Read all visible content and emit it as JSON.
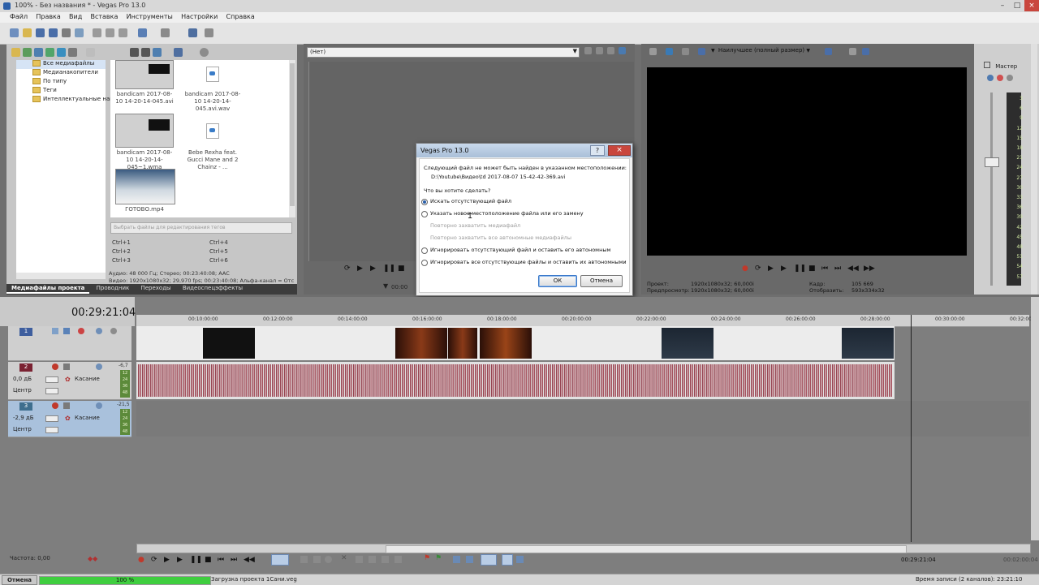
{
  "window": {
    "title": "100% - Без названия * - Vegas Pro 13.0"
  },
  "menu": [
    "Файл",
    "Правка",
    "Вид",
    "Вставка",
    "Инструменты",
    "Настройки",
    "Справка"
  ],
  "explorer": {
    "tree": [
      "Все медиафайлы",
      "Медианакопители",
      "По типу",
      "Теги",
      "Интеллектуальные нак"
    ],
    "items": [
      {
        "caption": "bandicam 2017-08-10 14-20-14-045.avi"
      },
      {
        "caption": "bandicam 2017-08-10 14-20-14-045.avi.wav",
        "icon": "wav-file-icon"
      },
      {
        "caption": "bandicam 2017-08-10 14-20-14-045~1.wma"
      },
      {
        "caption": "Bebe Rexha feat. Gucci Mane and 2 Chainz - ...",
        "icon": "wav-file-icon"
      },
      {
        "caption": "ГОТОВО.mp4"
      }
    ],
    "tag_placeholder": "Выбрать файлы для редактирования тегов",
    "shortcuts": [
      "Ctrl+1",
      "Ctrl+4",
      "Ctrl+2",
      "Ctrl+5",
      "Ctrl+3",
      "Ctrl+6"
    ],
    "info_audio": "Аудио: 48 000 Гц; Стерео; 00:23:40:08; AAC",
    "info_video": "Видео: 1920x1080x32; 29,970 fps; 00:23:40:08; Альфа-канал = Отс",
    "tabs": [
      "Медиафайлы проекта",
      "Проводник",
      "Переходы",
      "Видеоспецэффекты"
    ]
  },
  "trimmer": {
    "select_value": "(Нет)",
    "time": "00:00"
  },
  "preview": {
    "quality": "Наилучшее (полный размер)",
    "project_label": "Проект:",
    "project_value": "1920x1080x32; 60,000i",
    "preview_label": "Предпросмотр:",
    "preview_value": "1920x1080x32; 60,000i",
    "frame_label": "Кадр:",
    "frame_value": "105 669",
    "display_label": "Отобразить:",
    "display_value": "593x334x32"
  },
  "master": {
    "label": "Мастер",
    "scale": [
      "3",
      "6",
      "9",
      "12",
      "15",
      "18",
      "21",
      "24",
      "27",
      "30",
      "33",
      "36",
      "39",
      "42",
      "45",
      "48",
      "51",
      "54",
      "57"
    ]
  },
  "dialog": {
    "title": "Vegas Pro 13.0",
    "message": "Следующий файл не может быть найден в указанном местоположении:",
    "path": "D:\\Youtube\\Видео\\td 2017-08-07 15-42-42-369.avi",
    "question": "Что вы хотите сделать?",
    "options": [
      {
        "label": "Искать отсутствующий файл",
        "selected": true,
        "enabled": true
      },
      {
        "label": "Указать новое местоположение файла или его замену",
        "selected": false,
        "enabled": true
      },
      {
        "label": "Повторно захватить медиафайл",
        "selected": false,
        "enabled": false
      },
      {
        "label": "Повторно захватить все автономные медиафайлы",
        "selected": false,
        "enabled": false
      },
      {
        "label": "Игнорировать отсутствующий файл и оставить его автономным",
        "selected": false,
        "enabled": true
      },
      {
        "label": "Игнорировать все отсутствующие файлы и оставить их автономными",
        "selected": false,
        "enabled": true
      }
    ],
    "ok": "ОК",
    "cancel": "Отмена"
  },
  "timeline": {
    "timecode": "00:29:21:04",
    "ticks": [
      "00:10:00:00",
      "00:12:00:00",
      "00:14:00:00",
      "00:16:00:00",
      "00:18:00:00",
      "00:20:00:00",
      "00:22:00:00",
      "00:24:00:00",
      "00:26:00:00",
      "00:28:00:00",
      "00:30:00:00",
      "00:32:00"
    ],
    "tracks": [
      {
        "num": "1",
        "type": "video"
      },
      {
        "num": "2",
        "type": "audio",
        "vol": "0,0 дБ",
        "mode": "Касание",
        "pan": "Центр",
        "peak": "-6,7",
        "meter": [
          "12",
          "24",
          "36",
          "48"
        ]
      },
      {
        "num": "3",
        "type": "audio",
        "vol": "-2,9 дБ",
        "mode": "Касание",
        "pan": "Центр",
        "peak": "-21,5",
        "meter": [
          "12",
          "24",
          "36",
          "48"
        ]
      }
    ],
    "rate_label": "Частота: 0,00",
    "end_time": "00:29:21:04",
    "end_time2": "00:02:00:04"
  },
  "status": {
    "cancel": "Отмена",
    "progress": "100 %",
    "progress_value": 1.0,
    "message": "Загрузка проекта 1Сани.veg",
    "record_time": "Время записи (2 каналов): 23:21:10"
  }
}
